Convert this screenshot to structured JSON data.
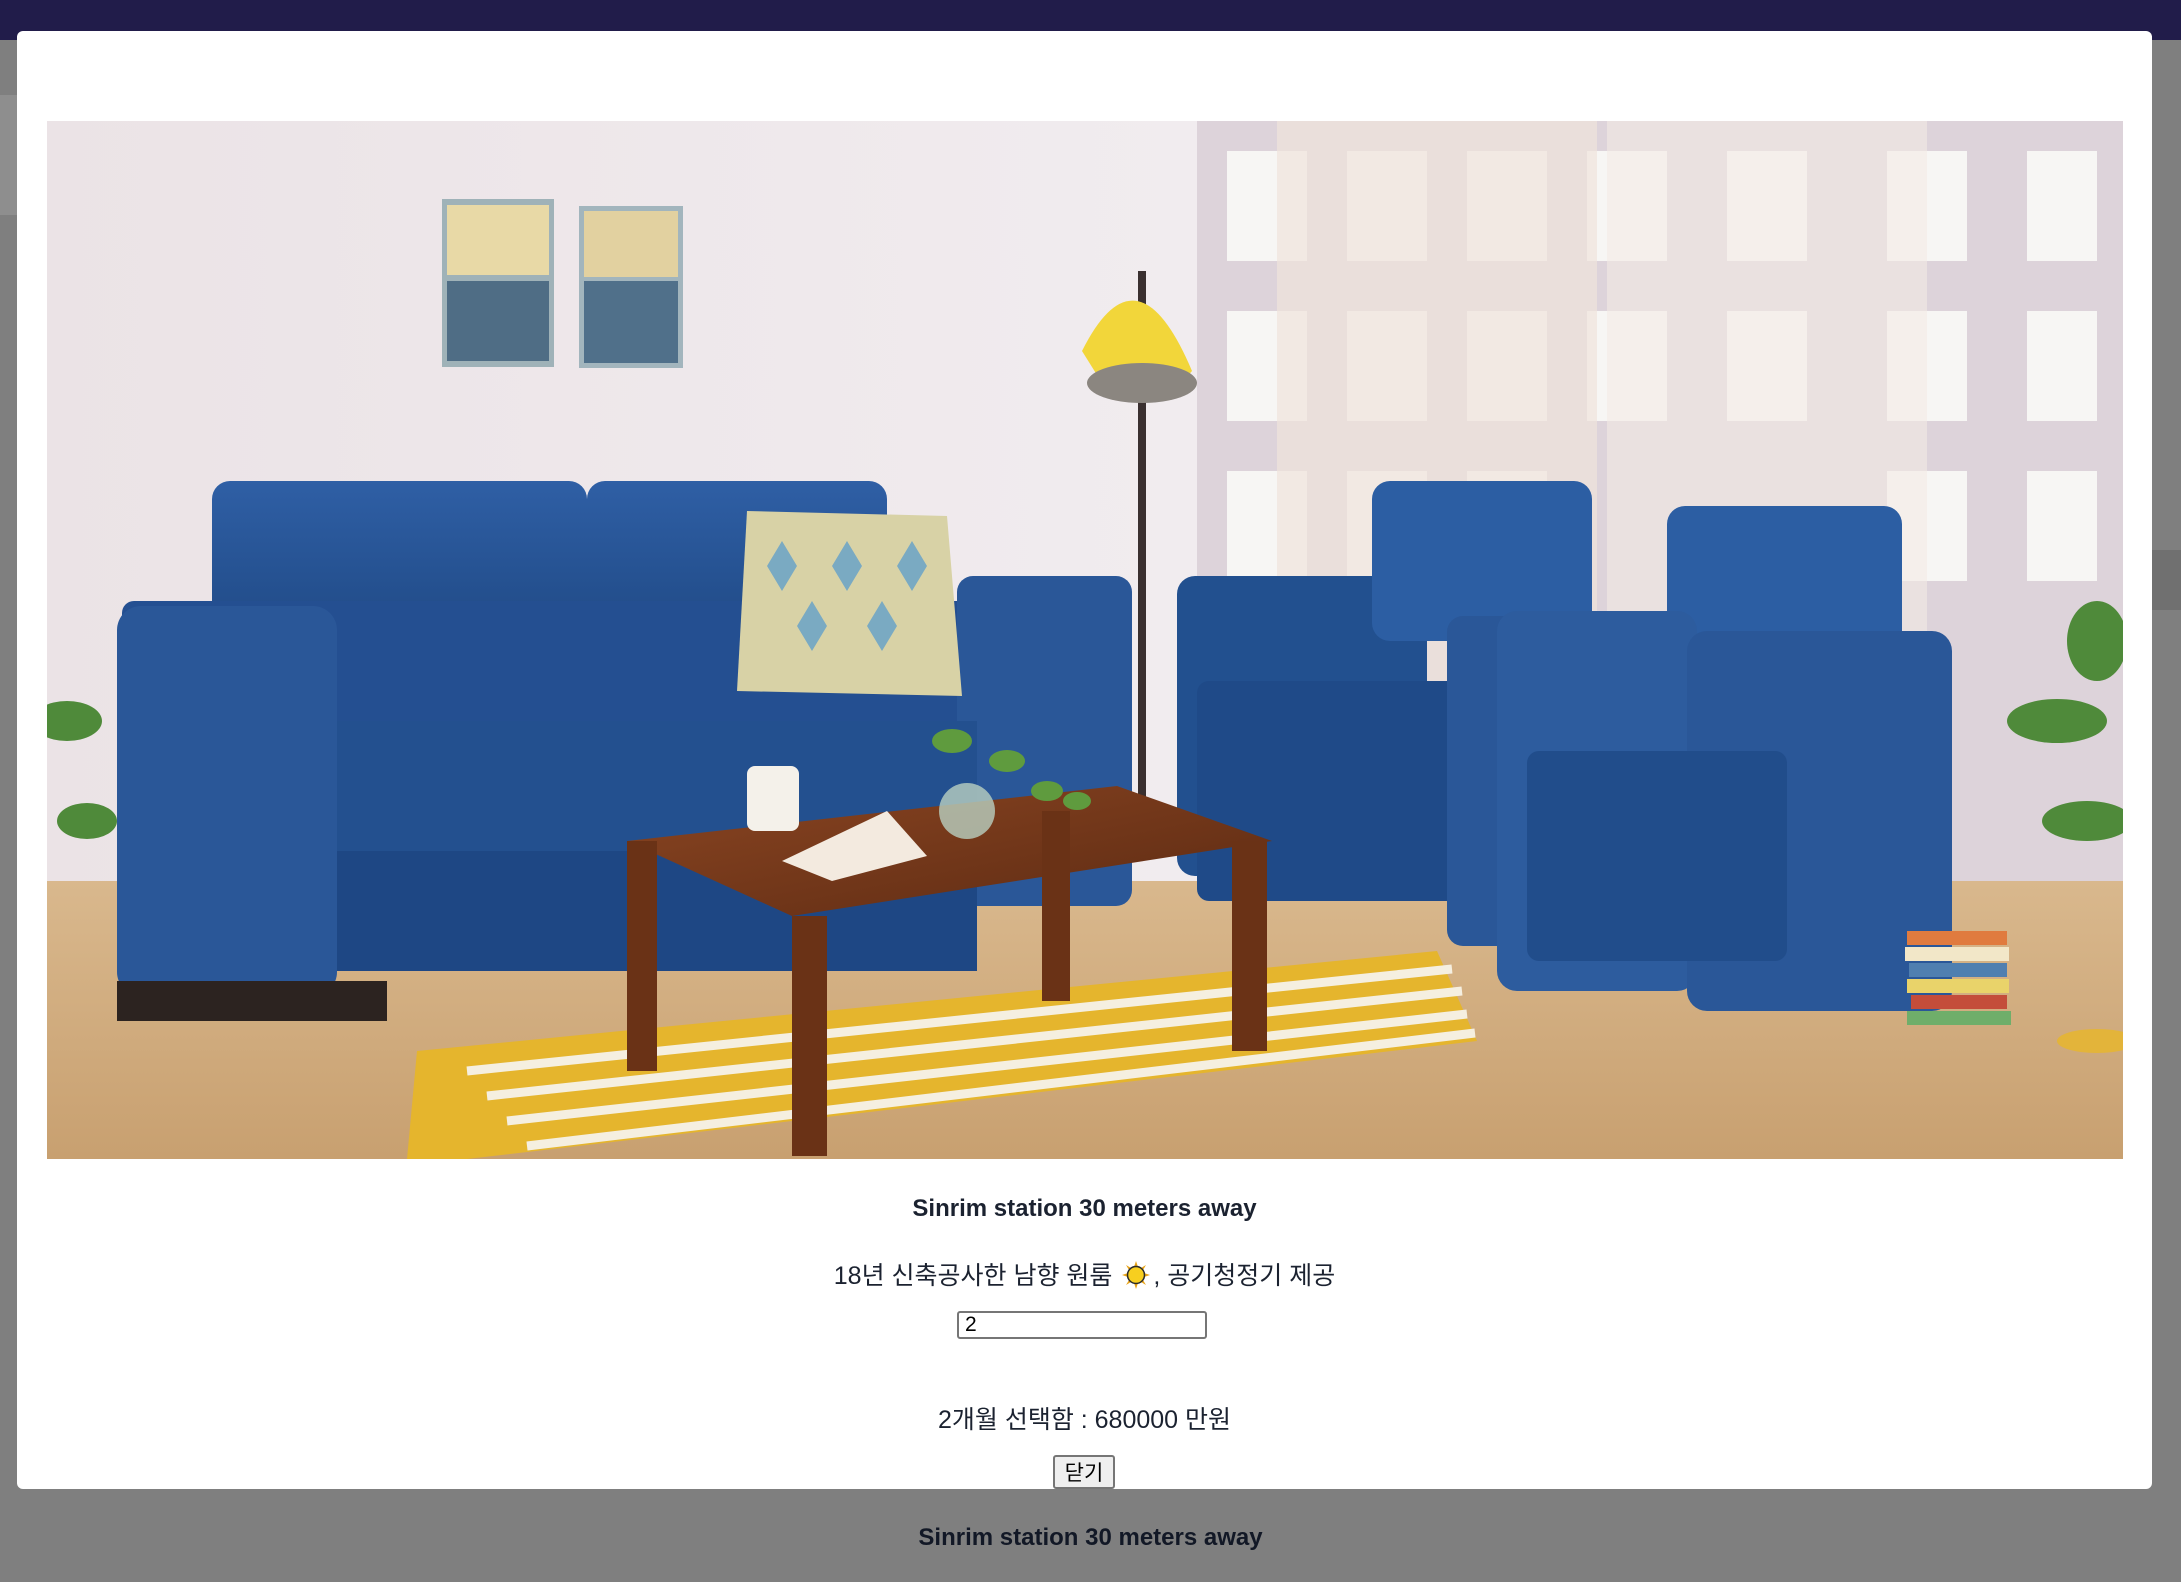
{
  "background_card": {
    "title": "Sinrim station 30 meters away"
  },
  "modal": {
    "image": {
      "alt": "Living room with blue sofa, two blue armchairs, wooden coffee table and striped yellow rug"
    },
    "title": "Sinrim station 30 meters away",
    "description_before_icon": "18년 신축공사한 남향 원룸 ",
    "description_icon": "sun-emoji-icon",
    "description_after_icon": ", 공기청정기 제공",
    "months_input": {
      "value": "2"
    },
    "summary": "2개월 선택함 : 680000 만원",
    "close_label": "닫기"
  },
  "colors": {
    "top_bar": "#211c4a",
    "overlay": "#7f7f7f",
    "modal_bg": "#ffffff",
    "text": "#1b2230"
  }
}
